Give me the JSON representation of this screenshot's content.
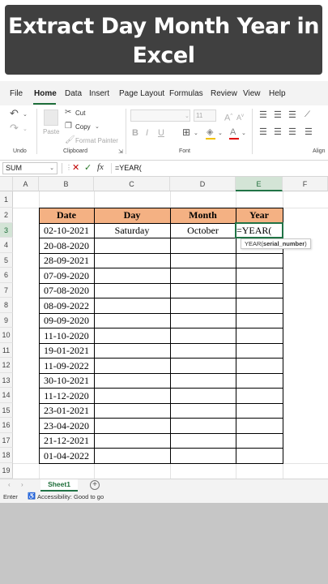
{
  "banner": {
    "title_line1": "Extract Day Month Year in",
    "title_line2": "Excel"
  },
  "menu": [
    "File",
    "Home",
    "Data",
    "Insert",
    "Page Layout",
    "Formulas",
    "Review",
    "View",
    "Help"
  ],
  "ribbon": {
    "undo_label": "Undo",
    "clipboard_label": "Clipboard",
    "font_label": "Font",
    "alignment_label": "Align",
    "paste": "Paste",
    "cut": "Cut",
    "copy": "Copy",
    "format_painter": "Format Painter",
    "font_size": "11"
  },
  "formula_bar": {
    "name_box": "SUM",
    "formula": "=YEAR("
  },
  "columns": [
    "A",
    "B",
    "C",
    "D",
    "E",
    "F"
  ],
  "rows": [
    "1",
    "2",
    "3",
    "4",
    "5",
    "6",
    "7",
    "8",
    "9",
    "10",
    "11",
    "12",
    "13",
    "14",
    "15",
    "16",
    "17",
    "18",
    "19"
  ],
  "table": {
    "headers": [
      "Date",
      "Day",
      "Month",
      "Year"
    ],
    "dates": [
      "02-10-2021",
      "20-08-2020",
      "28-09-2021",
      "07-09-2020",
      "07-08-2020",
      "08-09-2022",
      "09-09-2020",
      "11-10-2020",
      "19-01-2021",
      "11-09-2022",
      "30-10-2021",
      "11-12-2020",
      "23-01-2021",
      "23-04-2020",
      "21-12-2021",
      "01-04-2022"
    ],
    "row3": {
      "day": "Saturday",
      "month": "October",
      "year": "=YEAR("
    }
  },
  "tooltip": {
    "fn": "YEAR(",
    "arg": "serial_number",
    "close": ")"
  },
  "sheets": {
    "active": "Sheet1"
  },
  "status": {
    "mode": "Enter",
    "accessibility": "Accessibility: Good to go"
  },
  "colors": {
    "header_fill": "#f4b183",
    "accent": "#217346",
    "banner": "#404040"
  }
}
